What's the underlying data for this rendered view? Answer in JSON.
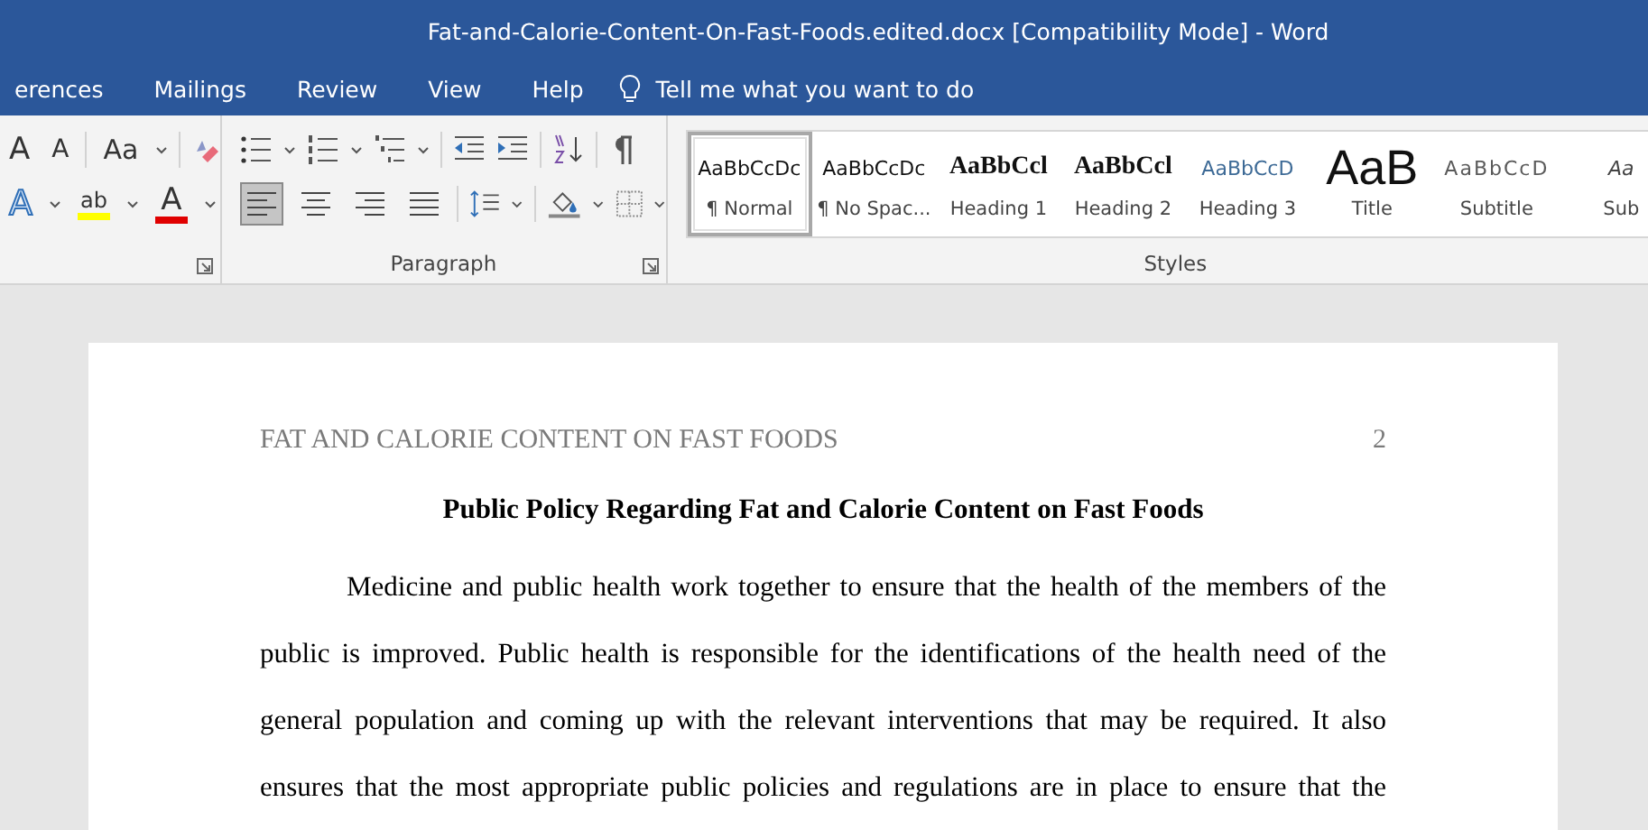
{
  "window": {
    "title": "Fat-and-Calorie-Content-On-Fast-Foods.edited.docx [Compatibility Mode]  -  Word"
  },
  "tabs": [
    {
      "label": "erences"
    },
    {
      "label": "Mailings"
    },
    {
      "label": "Review"
    },
    {
      "label": "View"
    },
    {
      "label": "Help"
    }
  ],
  "tell_me": {
    "placeholder": "Tell me what you want to do"
  },
  "font_group": {
    "grow_label": "A",
    "shrink_label": "A",
    "case_label": "Aa",
    "effects_label": "A",
    "highlight_label": "ab",
    "color_label": "A"
  },
  "paragraph_group": {
    "label": "Paragraph",
    "align_buttons": [
      {
        "kind": "left",
        "selected": true
      },
      {
        "kind": "center",
        "selected": false
      },
      {
        "kind": "right",
        "selected": false
      },
      {
        "kind": "justify",
        "selected": false
      }
    ]
  },
  "styles_group": {
    "label": "Styles",
    "styles": [
      {
        "kind": "normal",
        "preview": "AaBbCcDc",
        "name": "¶ Normal",
        "selected": true
      },
      {
        "kind": "normal",
        "preview": "AaBbCcDc",
        "name": "¶ No Spac...",
        "selected": false
      },
      {
        "kind": "heading",
        "preview": "AaBbCcl",
        "name": "Heading 1",
        "selected": false
      },
      {
        "kind": "heading",
        "preview": "AaBbCcl",
        "name": "Heading 2",
        "selected": false
      },
      {
        "kind": "accent",
        "preview": "AaBbCcD",
        "name": "Heading 3",
        "selected": false
      },
      {
        "kind": "title",
        "preview": "AaB",
        "name": "Title",
        "selected": false
      },
      {
        "kind": "subtitle",
        "preview": "AaBbCcD",
        "name": "Subtitle",
        "selected": false
      },
      {
        "kind": "emphasis",
        "preview": "Aa",
        "name": "Sub",
        "selected": false
      }
    ]
  },
  "document": {
    "header": "FAT AND CALORIE CONTENT ON FAST FOODS",
    "page_number": "2",
    "title": "Public Policy Regarding Fat and Calorie Content on Fast Foods",
    "lines": [
      "Medicine and public health work together to ensure that the health of the members of the",
      "public is improved.  Public health is responsible for the identifications of the health need of the",
      "general population and coming up with the relevant interventions that may be required. It also",
      "ensures that the most appropriate public policies and regulations are in place to ensure that the"
    ]
  }
}
